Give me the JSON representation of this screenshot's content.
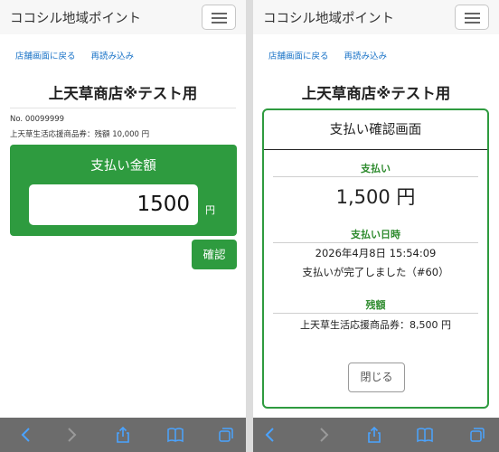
{
  "app": {
    "brand": "ココシル地域ポイント"
  },
  "nav": {
    "back_link": "店舗画面に戻る",
    "reload_link": "再読み込み"
  },
  "store": {
    "name": "上天草商店※テスト用"
  },
  "left": {
    "card_no": "No. 00099999",
    "balance_line": "上天草生活応援商品券：残額 10,000 円",
    "pay_title": "支払い金額",
    "amount_value": "1500",
    "yen": "円",
    "confirm_label": "確認"
  },
  "modal": {
    "title": "支払い確認画面",
    "payment_label": "支払い",
    "payment_value": "1,500 円",
    "datetime_label": "支払い日時",
    "datetime_value": "2026年4月8日 15:54:09",
    "complete_message": "支払いが完了しました（#60）",
    "balance_label": "残額",
    "balance_value": "上天草生活応援商品券：8,500 円",
    "close_label": "閉じる"
  },
  "toolbar": {
    "icons": [
      "back-arrow-icon",
      "forward-arrow-icon",
      "share-icon",
      "bookmarks-icon",
      "tabs-icon"
    ]
  },
  "colors": {
    "accent_green": "#2e9b3f",
    "label_green": "#2e8b2e",
    "link_blue": "#1a73c7",
    "toolbar": "#6c6c6c"
  }
}
